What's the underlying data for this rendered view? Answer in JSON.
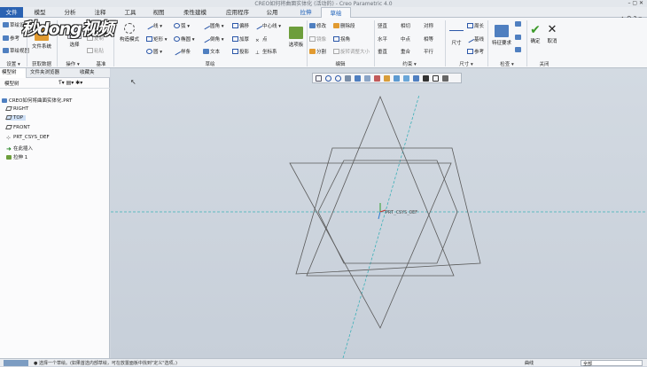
{
  "window": {
    "title": "CREO如何将曲面实体化 (活动的) - Creo Parametric 4.0",
    "controls": "–  ▢  ✕"
  },
  "tabs": [
    {
      "label": "文件"
    },
    {
      "label": "模型"
    },
    {
      "label": "分析"
    },
    {
      "label": "注释"
    },
    {
      "label": "工具"
    },
    {
      "label": "视图"
    },
    {
      "label": "柔性建模"
    },
    {
      "label": "应用程序"
    },
    {
      "label": "公用"
    },
    {
      "label": "拉伸"
    },
    {
      "label": "草绘"
    }
  ],
  "tab_right": "▲ ⚲ ? ▾",
  "watermark": "秒懂视频",
  "ribbon": {
    "setup": {
      "items": [
        "草绘设置",
        "参考",
        "草绘视图"
      ],
      "label": "设置 ▾"
    },
    "getdata": {
      "item": "文件系统",
      "label": "获取数据"
    },
    "operations": {
      "select": "选择",
      "items": [
        "剪切",
        "复制",
        "粘贴"
      ],
      "label": "操作 ▾"
    },
    "base": {
      "items": [
        "基准中心线",
        "点",
        "坐标系"
      ],
      "label": "基准"
    },
    "sketch": {
      "construction": "构造模式",
      "col1": [
        "线",
        "矩形",
        "圆"
      ],
      "col2": [
        "弧",
        "椭圆",
        "样条"
      ],
      "col3": [
        "圆角",
        "倒角",
        "文本"
      ],
      "col4": [
        "偏移",
        "加厚",
        "投影"
      ],
      "col5": [
        "中心线",
        "点",
        "坐标系"
      ],
      "palette": "选项板",
      "label": "草绘"
    },
    "editing": {
      "items": [
        "修改",
        "删除段",
        "镜像",
        "拐角",
        "分割",
        "旋转调整大小"
      ],
      "label": "编辑"
    },
    "constrain": {
      "items": [
        "竖直",
        "相切",
        "对称",
        "水平",
        "中点",
        "相等",
        "垂直",
        "重合",
        "平行"
      ],
      "label": "约束 ▾"
    },
    "dimension": {
      "big": "尺寸",
      "items": [
        "周长",
        "基线",
        "参考"
      ],
      "label": "尺寸 ▾"
    },
    "inspect": {
      "big": "特征要求",
      "label": "检查 ▾"
    },
    "close": {
      "ok": "确定",
      "cancel": "取消",
      "label": "关闭"
    }
  },
  "left_panel": {
    "tabs": [
      "模型树",
      "文件夹浏览器",
      "收藏夹"
    ],
    "toolbar_title": "模型树",
    "tree": [
      "CREO如何将曲面实体化.PRT",
      "RIGHT",
      "TOP",
      "FRONT",
      "PRT_CSYS_DEF",
      "在此插入",
      "拉伸 1"
    ]
  },
  "canvas": {
    "csys_label": "PRT_CSYS_DEF"
  },
  "status": {
    "text": "● 选择一个草绘。(如果首选内部草绘，可在放置面板中找到\"定义\"选项。)",
    "selection": "曲线",
    "filter": "全部"
  }
}
